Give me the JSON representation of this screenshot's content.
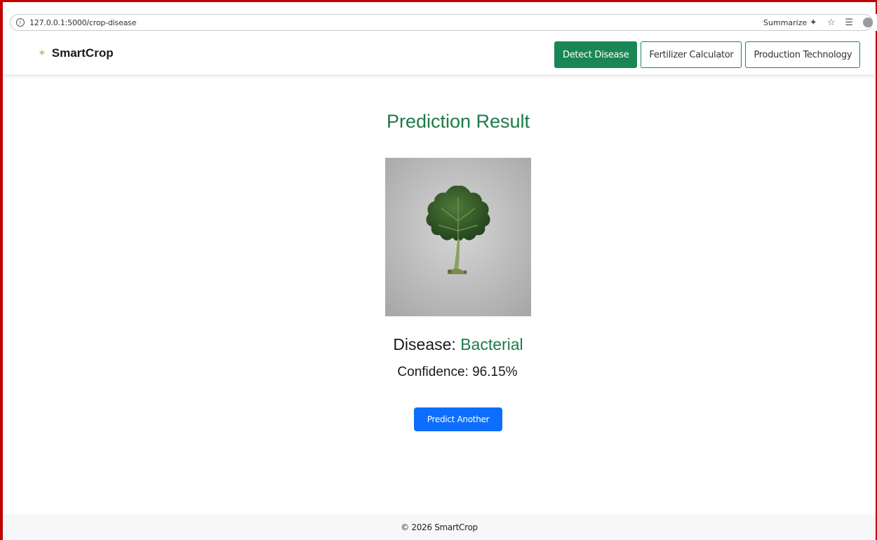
{
  "browser": {
    "url": "127.0.0.1:5000/crop-disease",
    "summarize_label": "Summarize",
    "icons": [
      "info-icon",
      "summarize-icon",
      "star-icon",
      "reading-list-icon",
      "profile-icon"
    ]
  },
  "navbar": {
    "brand": "SmartCrop",
    "brand_icon": "seedling-icon",
    "buttons": [
      {
        "label": "Detect Disease",
        "active": true
      },
      {
        "label": "Fertilizer Calculator",
        "active": false
      },
      {
        "label": "Production Technology",
        "active": false
      }
    ]
  },
  "result": {
    "title": "Prediction Result",
    "disease_label": "Disease:",
    "disease_value": "Bacterial",
    "confidence_label": "Confidence:",
    "confidence_value": "96.15%",
    "button_label": "Predict Another"
  },
  "footer": {
    "text": "© 2026 SmartCrop"
  },
  "colors": {
    "primary_green": "#198754",
    "title_green": "#1e7a46",
    "primary_blue": "#0d6efd",
    "frame_red": "#c00000"
  }
}
